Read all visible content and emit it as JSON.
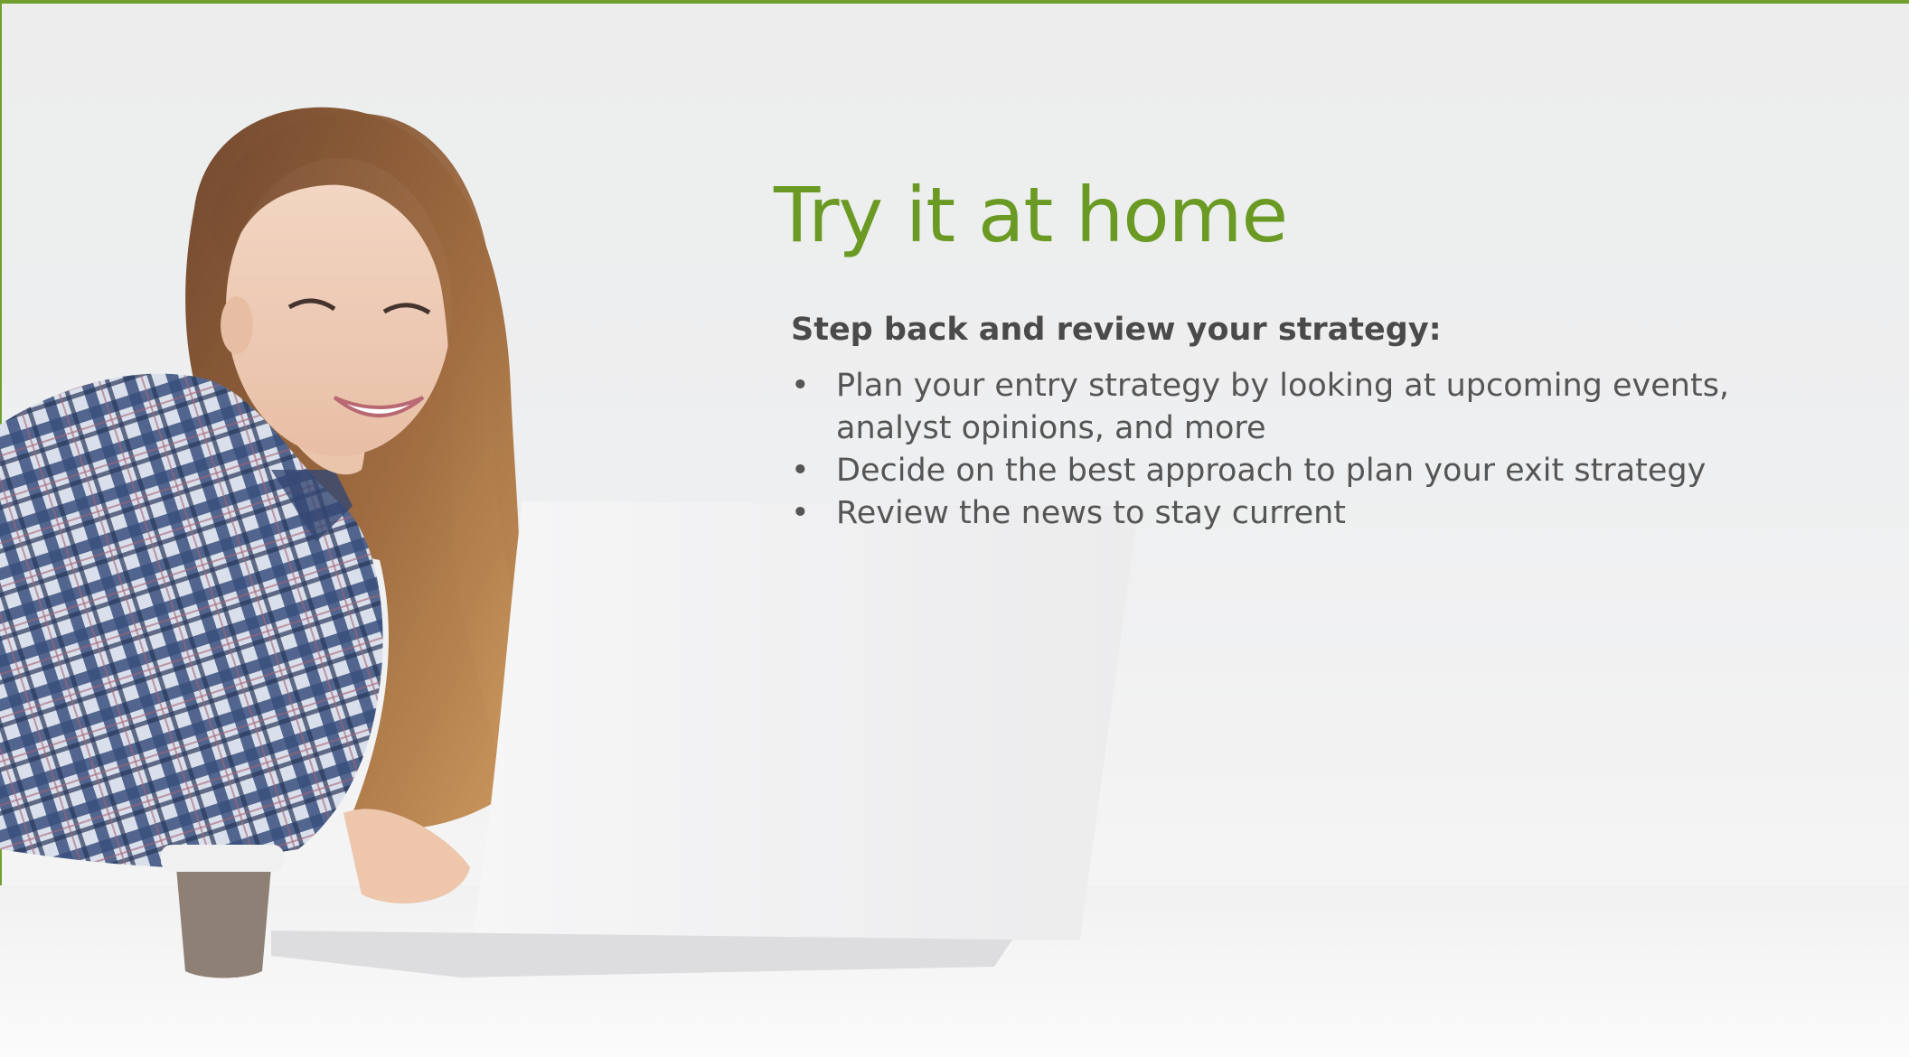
{
  "slide": {
    "title": "Try it at home",
    "subheading": "Step back and review your strategy:",
    "bullet_glyph": "•",
    "bullets": [
      "Plan your entry strategy by looking at upcoming events, analyst opinions, and more",
      "Decide on the best approach to plan your exit strategy",
      "Review the news to stay current"
    ]
  },
  "colors": {
    "accent_green": "#6a9a23",
    "body_text": "#555555",
    "subheading_text": "#4a4a4a"
  },
  "illustration": {
    "subject": "woman-with-laptop-photo",
    "elements": [
      "woman",
      "plaid-shirt",
      "laptop",
      "coffee-cup"
    ]
  }
}
